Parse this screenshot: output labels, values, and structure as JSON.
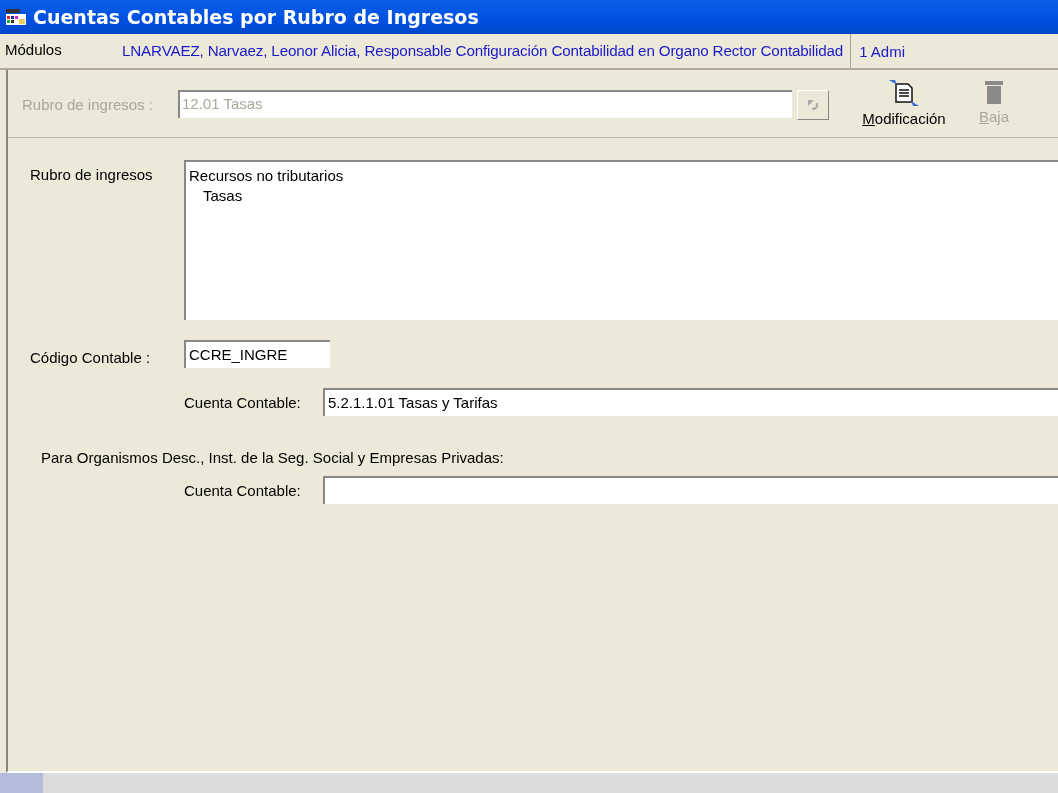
{
  "window": {
    "title": "Cuentas Contables por Rubro de Ingresos"
  },
  "menu_bar": {
    "modules_label": "Módulos",
    "user_info": "LNARVAEZ, Narvaez, Leonor Alicia, Responsable Configuración Contabilidad en Organo Rector Contabilidad",
    "section": "1 Admi"
  },
  "toolbar": {
    "field": {
      "label": "Rubro de ingresos :",
      "value": "12.01 Tasas",
      "disabled": true
    },
    "buttons": [
      {
        "kind": "edit",
        "label": "Modificación",
        "disabled": false
      },
      {
        "kind": "delete",
        "label": "Baja",
        "disabled": true
      }
    ]
  },
  "form": {
    "rubro": {
      "label": "Rubro de ingresos",
      "tree": [
        {
          "text": "Recursos no tributarios",
          "children": [
            {
              "text": "Tasas"
            }
          ]
        }
      ]
    },
    "codigo": {
      "label": "Código Contable :",
      "value": "CCRE_INGRE"
    },
    "cuenta": {
      "label": "Cuenta Contable:",
      "value": "5.2.1.1.01 Tasas y Tarifas"
    },
    "section_heading": "Para Organismos Desc., Inst. de la Seg. Social y Empresas Privadas:",
    "cuenta_privadas": {
      "label": "Cuenta Contable:"
    }
  }
}
